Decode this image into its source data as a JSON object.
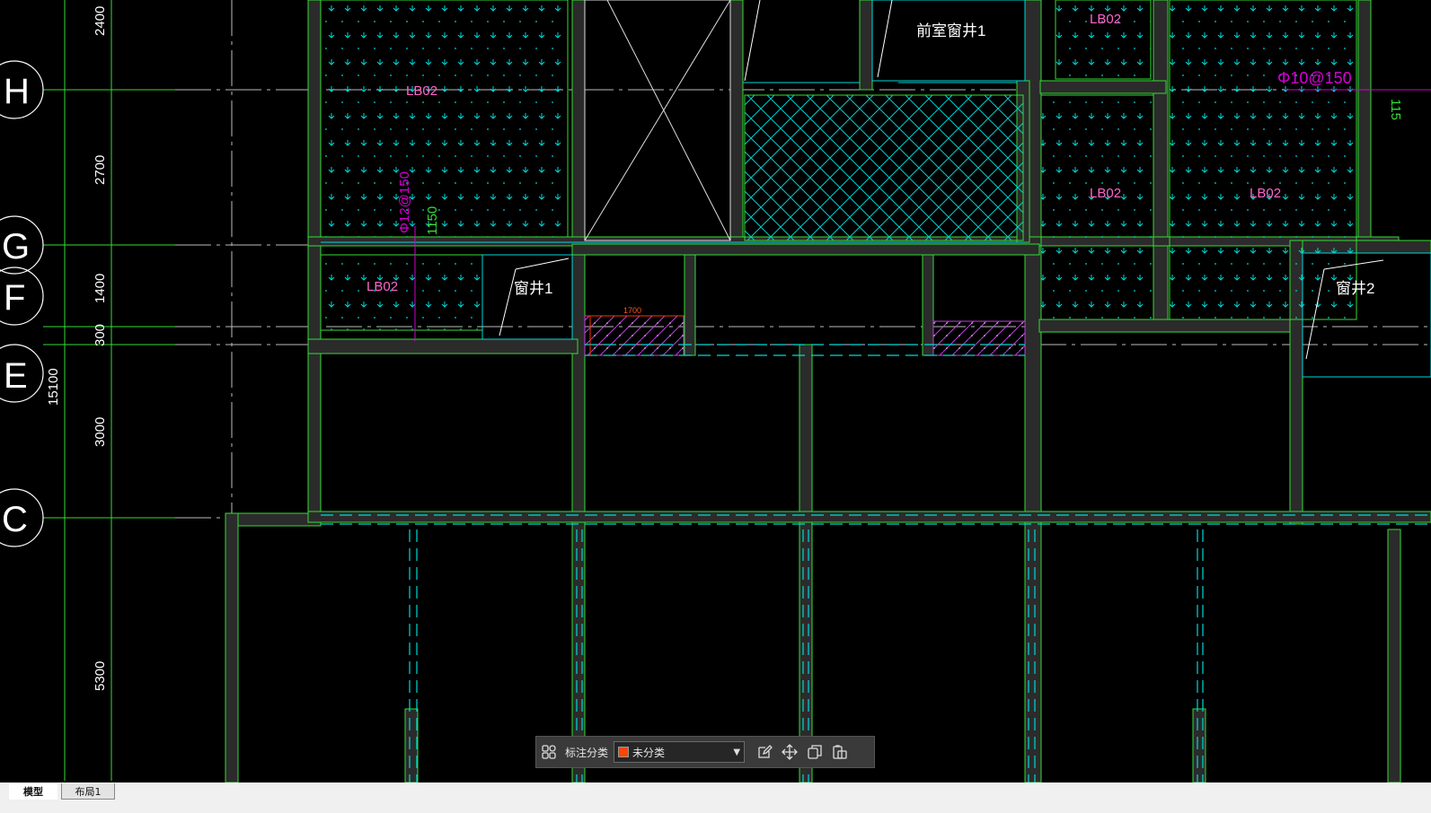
{
  "drawing": {
    "grid_axes": [
      "H",
      "G",
      "F",
      "E",
      "C"
    ],
    "dimensions": [
      "2400",
      "2700",
      "1400",
      "300",
      "3000",
      "5300",
      "15100"
    ],
    "slab_labels": [
      "LB02",
      "LB02",
      "LB02",
      "LB02",
      "LB02"
    ],
    "room_labels": {
      "vestibule_well": "前室窗井1",
      "window_well_1": "窗井1",
      "window_well_2": "窗井2"
    },
    "rebar_labels": {
      "top_right": "Φ10@150",
      "left_vertical": "Φ12@150"
    },
    "length_labels": {
      "left_vertical": "1150",
      "right_edge": "115"
    },
    "beam_dim": "1700",
    "colors": {
      "wall": "#33dd33",
      "hatch": "#00e6e6",
      "slab_label": "#ff66cc",
      "rebar": "#d400d4",
      "grid": "#cccccc",
      "beam": "#ff3300"
    }
  },
  "toolbar": {
    "label": "标注分类",
    "category_value": "未分类",
    "swatch_color": "#ff4400",
    "icons": [
      "grid-icon",
      "edit-icon",
      "move-icon",
      "copy-icon",
      "paste-icon"
    ]
  },
  "tabs": {
    "model": "模型",
    "layout": "布局1"
  }
}
